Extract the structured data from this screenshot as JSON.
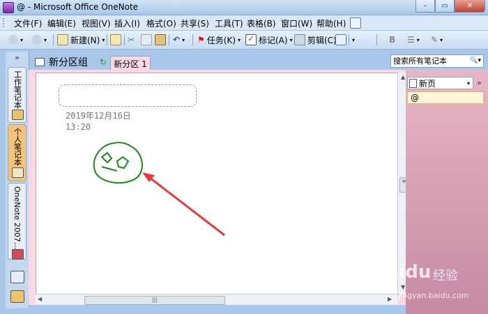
{
  "window": {
    "title": "@ - Microsoft Office OneNote"
  },
  "menu": [
    "文件(F)",
    "编辑(E)",
    "视图(V)",
    "插入(I)",
    "格式(O)",
    "共享(S)",
    "工具(T)",
    "表格(B)",
    "窗口(W)",
    "帮助(H)"
  ],
  "toolbar": {
    "new_label": "新建(N)",
    "task_label": "任务(K)",
    "flag_label": "标记(A)",
    "clip_label": "剪辑(C)",
    "bold_label": "B"
  },
  "notebook": {
    "title": "新分区组",
    "section_tab": "新分区 1"
  },
  "search": {
    "placeholder": "搜索所有笔记本"
  },
  "sidebar": {
    "tabs": [
      "工作笔记本",
      "个人笔记本",
      "OneNote 2007..."
    ],
    "chevron": "»"
  },
  "page": {
    "date": "2019年12月16日",
    "time": "13:20"
  },
  "right_panel": {
    "new_page": "新页",
    "page_items": [
      "@"
    ]
  },
  "watermark": {
    "logo": "Baidu",
    "jingyan": "经验",
    "url": "jingyan.baidu.com"
  },
  "colors": {
    "page_bg": "#fbd8e2",
    "drawing": "#1a8a1a",
    "arrow": "#e83a3a"
  }
}
